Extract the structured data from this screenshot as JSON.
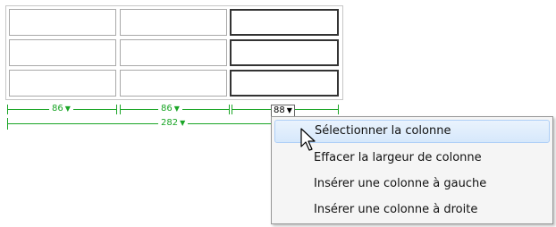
{
  "table": {
    "column_widths": [
      "86",
      "86",
      "88"
    ],
    "total_width": "282"
  },
  "context_menu": {
    "items": [
      {
        "label": "Sélectionner la colonne",
        "hover": true
      },
      {
        "label": "Effacer la largeur de colonne",
        "hover": false
      },
      {
        "label": "Insérer une colonne à gauche",
        "hover": false
      },
      {
        "label": "Insérer une colonne à droite",
        "hover": false
      }
    ]
  },
  "colors": {
    "measure": "#1aa526",
    "hover_bg": "#d6e8fb",
    "selected_cell_border": "#333333"
  },
  "icons": {
    "dropdown": "caret-down-icon",
    "cursor": "mouse-pointer-icon"
  }
}
